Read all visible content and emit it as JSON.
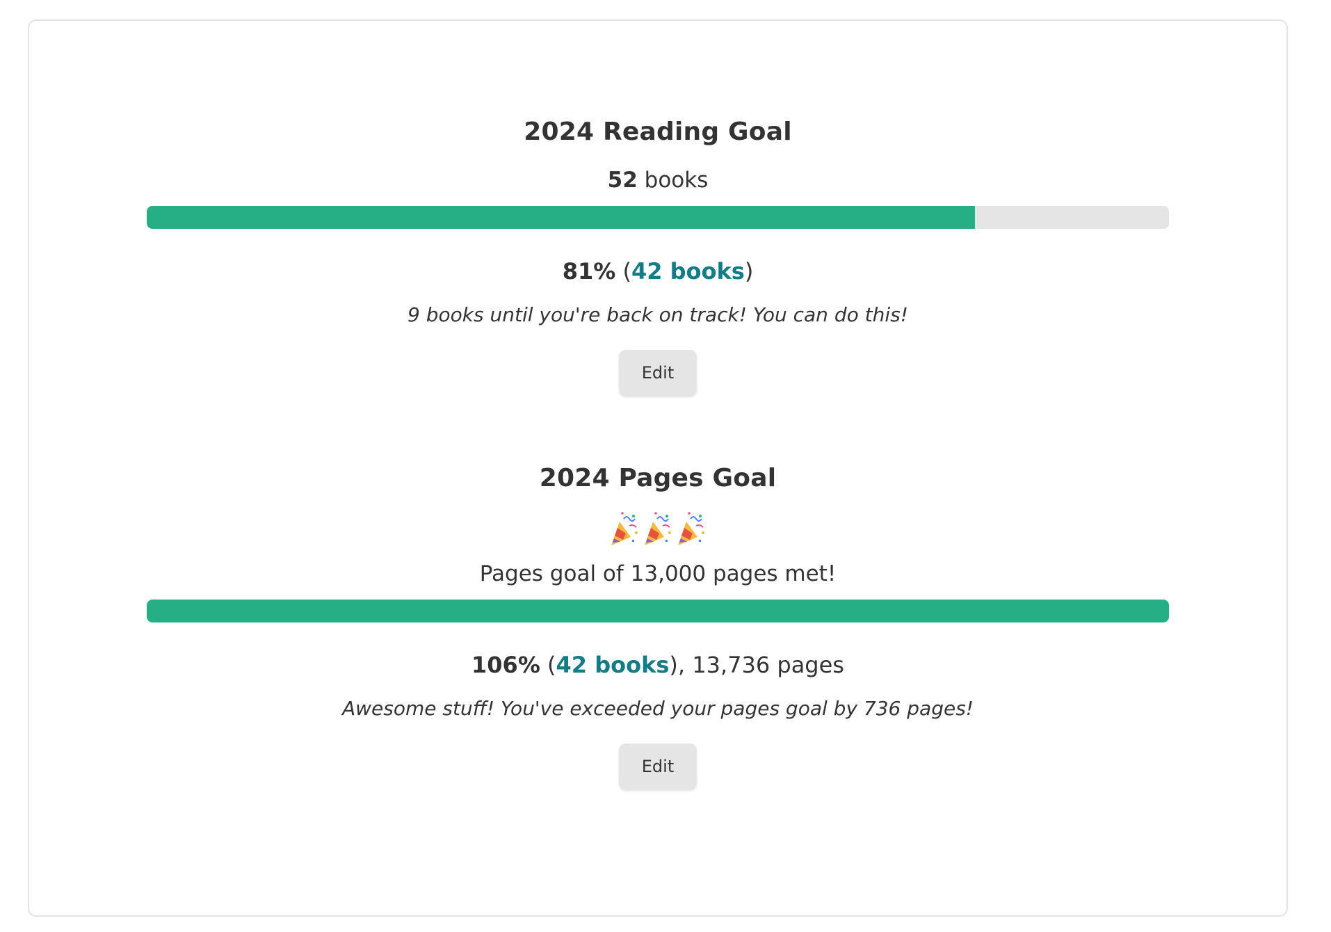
{
  "colors": {
    "progress_fill": "#26ae85",
    "progress_track": "#e5e5e5",
    "link": "#147c86",
    "text": "#333333",
    "button_bg": "#e5e5e5"
  },
  "reading_goal": {
    "title": "2024 Reading Goal",
    "target_count": "52",
    "target_unit": " books",
    "progress_fraction": 0.81,
    "percent_label": "81%",
    "open_paren": " (",
    "books_link": "42 books",
    "close_paren": ")",
    "message": "9 books until you're back on track! You can do this!",
    "edit_label": "Edit"
  },
  "pages_goal": {
    "title": "2024 Pages Goal",
    "celebration_icons": [
      "party-popper-icon",
      "party-popper-icon",
      "party-popper-icon"
    ],
    "met_text": "Pages goal of 13,000 pages met!",
    "progress_fraction": 1.0,
    "percent_label": "106%",
    "open_paren": " (",
    "books_link": "42 books",
    "close_paren_pages": "), 13,736 pages",
    "message": "Awesome stuff! You've exceeded your pages goal by 736 pages!",
    "edit_label": "Edit"
  }
}
